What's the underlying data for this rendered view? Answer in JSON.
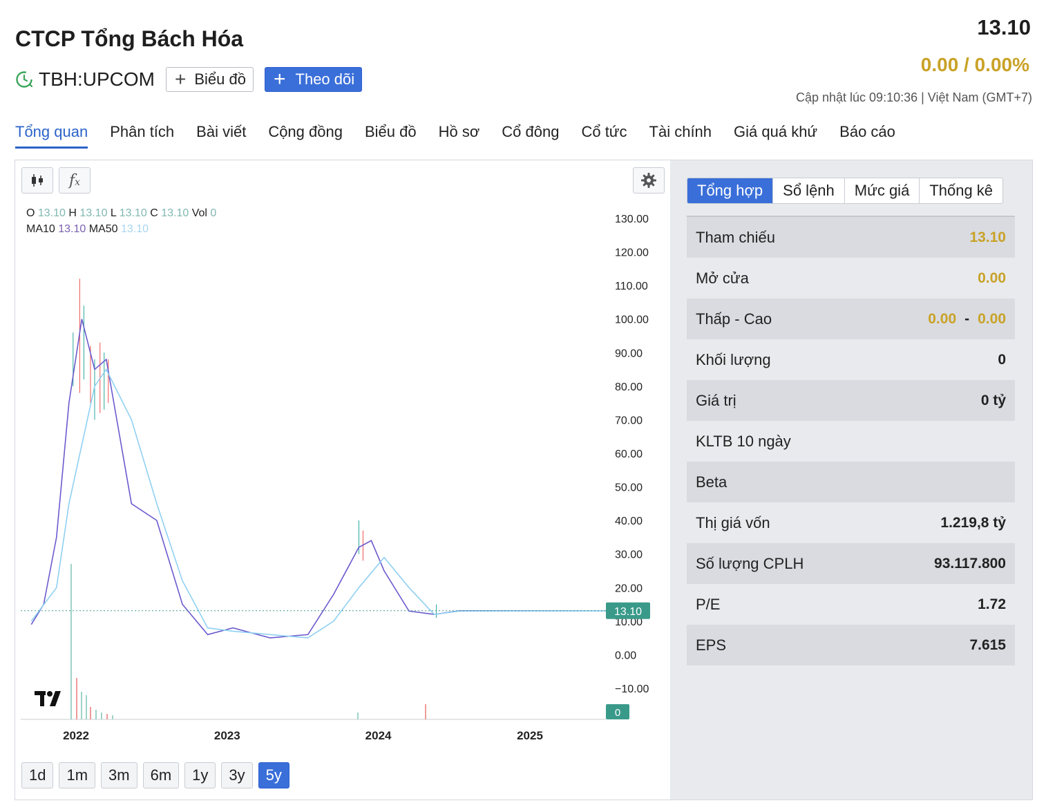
{
  "header": {
    "company_name": "CTCP Tổng Bách Hóa",
    "ticker": "TBH:UPCOM",
    "chart_button_label": "Biểu đồ",
    "follow_button_label": "Theo dõi",
    "price": "13.10",
    "change": "0.00 / 0.00%",
    "updated_label": "Cập nhật lúc  09:10:36 | Việt Nam (GMT+7)"
  },
  "tabs": [
    "Tổng quan",
    "Phân tích",
    "Bài viết",
    "Cộng đồng",
    "Biểu đồ",
    "Hồ sơ",
    "Cổ đông",
    "Cổ tức",
    "Tài chính",
    "Giá quá khứ",
    "Báo cáo"
  ],
  "chart": {
    "ohlc": {
      "o_label": "O",
      "o": "13.10",
      "h_label": "H",
      "h": "13.10",
      "l_label": "L",
      "l": "13.10",
      "c_label": "C",
      "c": "13.10",
      "vol_label": "Vol",
      "vol": "0"
    },
    "ma": {
      "ma10_label": "MA10",
      "ma10": "13.10",
      "ma50_label": "MA50",
      "ma50": "13.10"
    },
    "y_ticks": [
      "130.00",
      "120.00",
      "110.00",
      "100.00",
      "90.00",
      "80.00",
      "70.00",
      "60.00",
      "50.00",
      "40.00",
      "30.00",
      "20.00",
      "10.00",
      "0.00",
      "−10.00"
    ],
    "x_ticks": [
      "2022",
      "2023",
      "2024",
      "2025"
    ],
    "last_price_label": "13.10",
    "volume_label": "0",
    "ranges": [
      "1d",
      "1m",
      "3m",
      "6m",
      "1y",
      "3y",
      "5y"
    ],
    "active_range": "5y",
    "colors": {
      "up": "#26a69a",
      "down": "#ef5350",
      "ma10": "#6a5acd",
      "ma50": "#8fd0f2",
      "last": "#3a9a8a"
    }
  },
  "chart_data": {
    "type": "line",
    "title": "",
    "x_ticks": [
      "2022",
      "2023",
      "2024",
      "2025"
    ],
    "ylim": [
      -10,
      130
    ],
    "series": [
      {
        "name": "MA10",
        "x": [
          "2021-09",
          "2021-10",
          "2021-11",
          "2021-12",
          "2022-01",
          "2022-02",
          "2022-03",
          "2022-05",
          "2022-07",
          "2022-09",
          "2022-11",
          "2023-01",
          "2023-04",
          "2023-07",
          "2023-09",
          "2023-11",
          "2023-12",
          "2024-01",
          "2024-03",
          "2024-05",
          "2024-07",
          "2025-08"
        ],
        "y": [
          9,
          15,
          35,
          75,
          100,
          85,
          88,
          45,
          40,
          15,
          6,
          8,
          5,
          6,
          18,
          32,
          34,
          25,
          13,
          12,
          13.1,
          13.1
        ]
      },
      {
        "name": "MA50",
        "x": [
          "2021-09",
          "2021-11",
          "2021-12",
          "2022-02",
          "2022-03",
          "2022-05",
          "2022-07",
          "2022-09",
          "2022-11",
          "2023-01",
          "2023-04",
          "2023-07",
          "2023-09",
          "2023-11",
          "2024-01",
          "2024-03",
          "2024-05",
          "2024-07",
          "2025-08"
        ],
        "y": [
          10,
          20,
          45,
          80,
          85,
          70,
          45,
          22,
          8,
          7,
          6,
          5,
          10,
          20,
          29,
          20,
          12,
          13,
          13.1
        ]
      }
    ]
  },
  "sidebar": {
    "tabs": [
      "Tổng hợp",
      "Sổ lệnh",
      "Mức giá",
      "Thống kê"
    ],
    "active_tab": "Tổng hợp",
    "rows": [
      {
        "label": "Tham chiếu",
        "value": "13.10"
      },
      {
        "label": "Mở cửa",
        "value": "0.00"
      },
      {
        "label": "Thấp - Cao",
        "low": "0.00",
        "dash": "-",
        "high": "0.00"
      },
      {
        "label": "Khối lượng",
        "value": "0"
      },
      {
        "label": "Giá trị",
        "value": "0 tỷ"
      },
      {
        "label": "KLTB 10 ngày",
        "value": ""
      },
      {
        "label": "Beta",
        "value": ""
      },
      {
        "label": "Thị giá vốn",
        "value": "1.219,8 tỷ"
      },
      {
        "label": "Số lượng CPLH",
        "value": "93.117.800"
      },
      {
        "label": "P/E",
        "value": "1.72"
      },
      {
        "label": "EPS",
        "value": "7.615"
      }
    ],
    "gold_color": "#c9a227"
  }
}
